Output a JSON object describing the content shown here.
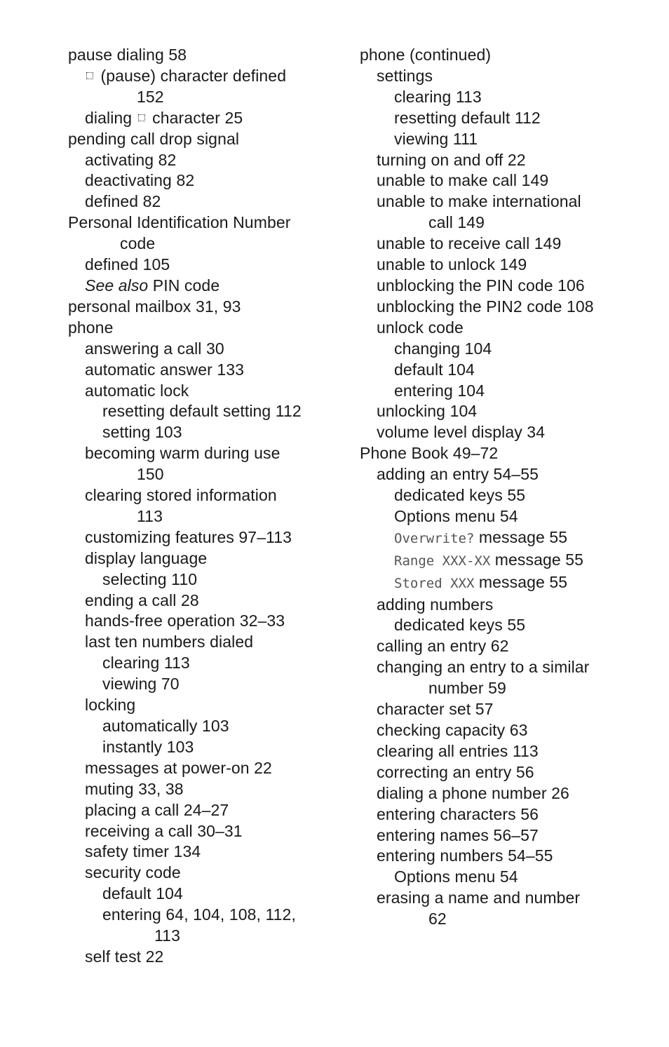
{
  "columns": [
    {
      "name": "left",
      "entries": [
        {
          "level": 0,
          "parts": [
            {
              "t": "pause dialing  58"
            }
          ]
        },
        {
          "level": 1,
          "parts": [
            {
              "icon": "pause"
            },
            {
              "t": " (pause) character defined"
            }
          ],
          "cont": "152"
        },
        {
          "level": 1,
          "parts": [
            {
              "t": "dialing "
            },
            {
              "icon": "pause"
            },
            {
              "t": " character  25"
            }
          ]
        },
        {
          "level": 0,
          "parts": [
            {
              "t": "pending call drop signal"
            }
          ]
        },
        {
          "level": 1,
          "parts": [
            {
              "t": "activating  82"
            }
          ]
        },
        {
          "level": 1,
          "parts": [
            {
              "t": "deactivating  82"
            }
          ]
        },
        {
          "level": 1,
          "parts": [
            {
              "t": "defined  82"
            }
          ]
        },
        {
          "level": 0,
          "parts": [
            {
              "t": "Personal Identification Number"
            }
          ],
          "cont": "code"
        },
        {
          "level": 1,
          "parts": [
            {
              "t": "defined  105"
            }
          ]
        },
        {
          "level": 1,
          "parts": [
            {
              "t": "See also",
              "style": "ital"
            },
            {
              "t": " PIN code"
            }
          ]
        },
        {
          "level": 0,
          "parts": [
            {
              "t": "personal mailbox  31, 93"
            }
          ]
        },
        {
          "level": 0,
          "parts": [
            {
              "t": "phone"
            }
          ]
        },
        {
          "level": 1,
          "parts": [
            {
              "t": "answering a call  30"
            }
          ]
        },
        {
          "level": 1,
          "parts": [
            {
              "t": "automatic answer  133"
            }
          ]
        },
        {
          "level": 1,
          "parts": [
            {
              "t": "automatic lock"
            }
          ]
        },
        {
          "level": 2,
          "parts": [
            {
              "t": "resetting default setting  112"
            }
          ]
        },
        {
          "level": 2,
          "parts": [
            {
              "t": "setting  103"
            }
          ]
        },
        {
          "level": 1,
          "parts": [
            {
              "t": "becoming warm during use"
            }
          ],
          "cont": "150"
        },
        {
          "level": 1,
          "parts": [
            {
              "t": "clearing stored information"
            }
          ],
          "cont": "113"
        },
        {
          "level": 1,
          "parts": [
            {
              "t": "customizing features  97–113"
            }
          ]
        },
        {
          "level": 1,
          "parts": [
            {
              "t": "display language"
            }
          ]
        },
        {
          "level": 2,
          "parts": [
            {
              "t": "selecting  110"
            }
          ]
        },
        {
          "level": 1,
          "parts": [
            {
              "t": "ending a call  28"
            }
          ]
        },
        {
          "level": 1,
          "parts": [
            {
              "t": "hands-free operation  32–33"
            }
          ]
        },
        {
          "level": 1,
          "parts": [
            {
              "t": "last ten numbers dialed"
            }
          ]
        },
        {
          "level": 2,
          "parts": [
            {
              "t": "clearing  113"
            }
          ]
        },
        {
          "level": 2,
          "parts": [
            {
              "t": "viewing  70"
            }
          ]
        },
        {
          "level": 1,
          "parts": [
            {
              "t": "locking"
            }
          ]
        },
        {
          "level": 2,
          "parts": [
            {
              "t": "automatically  103"
            }
          ]
        },
        {
          "level": 2,
          "parts": [
            {
              "t": "instantly  103"
            }
          ]
        },
        {
          "level": 1,
          "parts": [
            {
              "t": "messages at power-on  22"
            }
          ]
        },
        {
          "level": 1,
          "parts": [
            {
              "t": "muting  33, 38"
            }
          ]
        },
        {
          "level": 1,
          "parts": [
            {
              "t": "placing a call  24–27"
            }
          ]
        },
        {
          "level": 1,
          "parts": [
            {
              "t": "receiving a call  30–31"
            }
          ]
        },
        {
          "level": 1,
          "parts": [
            {
              "t": "safety timer  134"
            }
          ]
        },
        {
          "level": 1,
          "parts": [
            {
              "t": "security code"
            }
          ]
        },
        {
          "level": 2,
          "parts": [
            {
              "t": "default  104"
            }
          ]
        },
        {
          "level": 2,
          "parts": [
            {
              "t": "entering  64, 104, 108, 112,"
            }
          ],
          "cont": "113"
        },
        {
          "level": 1,
          "parts": [
            {
              "t": "self test  22"
            }
          ]
        }
      ]
    },
    {
      "name": "right",
      "entries": [
        {
          "level": 0,
          "parts": [
            {
              "t": "phone (continued)"
            }
          ]
        },
        {
          "level": 1,
          "parts": [
            {
              "t": "settings"
            }
          ]
        },
        {
          "level": 2,
          "parts": [
            {
              "t": "clearing  113"
            }
          ]
        },
        {
          "level": 2,
          "parts": [
            {
              "t": "resetting default  112"
            }
          ]
        },
        {
          "level": 2,
          "parts": [
            {
              "t": "viewing  111"
            }
          ]
        },
        {
          "level": 1,
          "parts": [
            {
              "t": "turning on and off  22"
            }
          ]
        },
        {
          "level": 1,
          "parts": [
            {
              "t": "unable to make call  149"
            }
          ]
        },
        {
          "level": 1,
          "parts": [
            {
              "t": "unable to make international"
            }
          ],
          "cont": "call  149"
        },
        {
          "level": 1,
          "parts": [
            {
              "t": "unable to receive call  149"
            }
          ]
        },
        {
          "level": 1,
          "parts": [
            {
              "t": "unable to unlock  149"
            }
          ]
        },
        {
          "level": 1,
          "parts": [
            {
              "t": "unblocking the PIN code  106"
            }
          ]
        },
        {
          "level": 1,
          "parts": [
            {
              "t": "unblocking the PIN2 code  108"
            }
          ]
        },
        {
          "level": 1,
          "parts": [
            {
              "t": "unlock code"
            }
          ]
        },
        {
          "level": 2,
          "parts": [
            {
              "t": "changing  104"
            }
          ]
        },
        {
          "level": 2,
          "parts": [
            {
              "t": "default  104"
            }
          ]
        },
        {
          "level": 2,
          "parts": [
            {
              "t": "entering  104"
            }
          ]
        },
        {
          "level": 1,
          "parts": [
            {
              "t": "unlocking  104"
            }
          ]
        },
        {
          "level": 1,
          "parts": [
            {
              "t": "volume level display  34"
            }
          ]
        },
        {
          "level": 0,
          "parts": [
            {
              "t": "Phone Book  49–72"
            }
          ]
        },
        {
          "level": 1,
          "parts": [
            {
              "t": "adding an entry  54–55"
            }
          ]
        },
        {
          "level": 2,
          "parts": [
            {
              "t": "dedicated keys  55"
            }
          ]
        },
        {
          "level": 2,
          "parts": [
            {
              "t": "Options menu  54"
            }
          ]
        },
        {
          "level": 2,
          "parts": [
            {
              "t": "Overwrite?",
              "style": "lcd"
            },
            {
              "t": " message  55"
            }
          ]
        },
        {
          "level": 2,
          "parts": [
            {
              "t": "Range XXX-XX",
              "style": "lcd"
            },
            {
              "t": " message  55"
            }
          ]
        },
        {
          "level": 2,
          "parts": [
            {
              "t": "Stored XXX",
              "style": "lcd"
            },
            {
              "t": " message  55"
            }
          ]
        },
        {
          "level": 1,
          "parts": [
            {
              "t": "adding numbers"
            }
          ]
        },
        {
          "level": 2,
          "parts": [
            {
              "t": "dedicated keys  55"
            }
          ]
        },
        {
          "level": 1,
          "parts": [
            {
              "t": "calling an entry  62"
            }
          ]
        },
        {
          "level": 1,
          "parts": [
            {
              "t": "changing an entry to a similar"
            }
          ],
          "cont": "number  59"
        },
        {
          "level": 1,
          "parts": [
            {
              "t": "character set  57"
            }
          ]
        },
        {
          "level": 1,
          "parts": [
            {
              "t": "checking capacity  63"
            }
          ]
        },
        {
          "level": 1,
          "parts": [
            {
              "t": "clearing all entries  113"
            }
          ]
        },
        {
          "level": 1,
          "parts": [
            {
              "t": "correcting an entry  56"
            }
          ]
        },
        {
          "level": 1,
          "parts": [
            {
              "t": "dialing a phone number  26"
            }
          ]
        },
        {
          "level": 1,
          "parts": [
            {
              "t": "entering characters  56"
            }
          ]
        },
        {
          "level": 1,
          "parts": [
            {
              "t": "entering names  56–57"
            }
          ]
        },
        {
          "level": 1,
          "parts": [
            {
              "t": "entering numbers  54–55"
            }
          ]
        },
        {
          "level": 2,
          "parts": [
            {
              "t": "Options menu  54"
            }
          ]
        },
        {
          "level": 1,
          "parts": [
            {
              "t": "erasing a name and number"
            }
          ],
          "cont": "62"
        }
      ]
    }
  ]
}
